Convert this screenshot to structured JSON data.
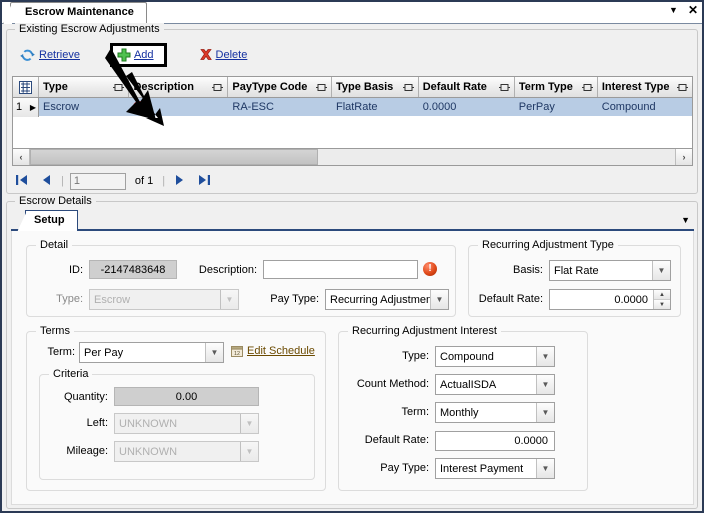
{
  "window": {
    "tab_title": "Escrow Maintenance",
    "caret_icon": "chevron-down-icon",
    "close_icon": "close-icon",
    "close_glyph": "✕",
    "caret_glyph": "▼"
  },
  "existing": {
    "group_title": "Existing Escrow Adjustments",
    "toolbar": {
      "retrieve_label": "Retrieve",
      "add_label": "Add",
      "delete_label": "Delete"
    },
    "grid": {
      "row_indicator_icon": "column-chooser-icon",
      "columns": [
        "Type",
        "Description",
        "PayType Code",
        "Type Basis",
        "Default Rate",
        "Term Type",
        "Interest Type"
      ],
      "rows": [
        {
          "index": "1",
          "type": "Escrow",
          "description": "",
          "description_error_icon": "error-icon",
          "paytype_code": "RA-ESC",
          "type_basis": "FlatRate",
          "default_rate": "0.0000",
          "term_type": "PerPay",
          "interest_type": "Compound"
        }
      ]
    },
    "scroll": {
      "left_glyph": "‹",
      "right_glyph": "›"
    },
    "pager": {
      "first_glyph": "◀❘",
      "prev_glyph": "◀",
      "next_glyph": "▶",
      "last_glyph": "❘▶",
      "page_value": "1",
      "of_text": "of 1"
    }
  },
  "details": {
    "group_title": "Escrow Details",
    "tabs": [
      {
        "label": "Setup",
        "active": true
      }
    ],
    "tab_overflow_glyph": "▼",
    "detail_panel": {
      "title": "Detail",
      "id_label": "ID:",
      "id_value": "-2147483648",
      "description_label": "Description:",
      "description_value": "",
      "description_error_icon": "error-icon",
      "type_label": "Type:",
      "type_value": "Escrow",
      "paytype_label": "Pay Type:",
      "paytype_value": "Recurring Adjustmen"
    },
    "ra_type_panel": {
      "title": "Recurring Adjustment Type",
      "basis_label": "Basis:",
      "basis_value": "Flat Rate",
      "default_rate_label": "Default Rate:",
      "default_rate_value": "0.0000"
    },
    "terms_panel": {
      "title": "Terms",
      "term_label": "Term:",
      "term_value": "Per Pay",
      "edit_schedule_label": "Edit Schedule",
      "edit_schedule_icon": "calendar-icon",
      "criteria": {
        "title": "Criteria",
        "quantity_label": "Quantity:",
        "quantity_value": "0.00",
        "left_label": "Left:",
        "left_value": "UNKNOWN",
        "mileage_label": "Mileage:",
        "mileage_value": "UNKNOWN"
      }
    },
    "interest_panel": {
      "title": "Recurring Adjustment Interest",
      "type_label": "Type:",
      "type_value": "Compound",
      "count_method_label": "Count Method:",
      "count_method_value": "ActualISDA",
      "term_label": "Term:",
      "term_value": "Monthly",
      "default_rate_label": "Default Rate:",
      "default_rate_value": "0.0000",
      "paytype_label": "Pay Type:",
      "paytype_value": "Interest Payment"
    }
  },
  "annotation": {
    "arrow_icon": "callout-arrow-icon",
    "highlight_target": "Add"
  },
  "colors": {
    "selection_row": "#b8cce4",
    "link": "#1430a0",
    "error": "#d81f1f",
    "tab_underline": "#2c4a7c",
    "window_border": "#2b3a55"
  }
}
